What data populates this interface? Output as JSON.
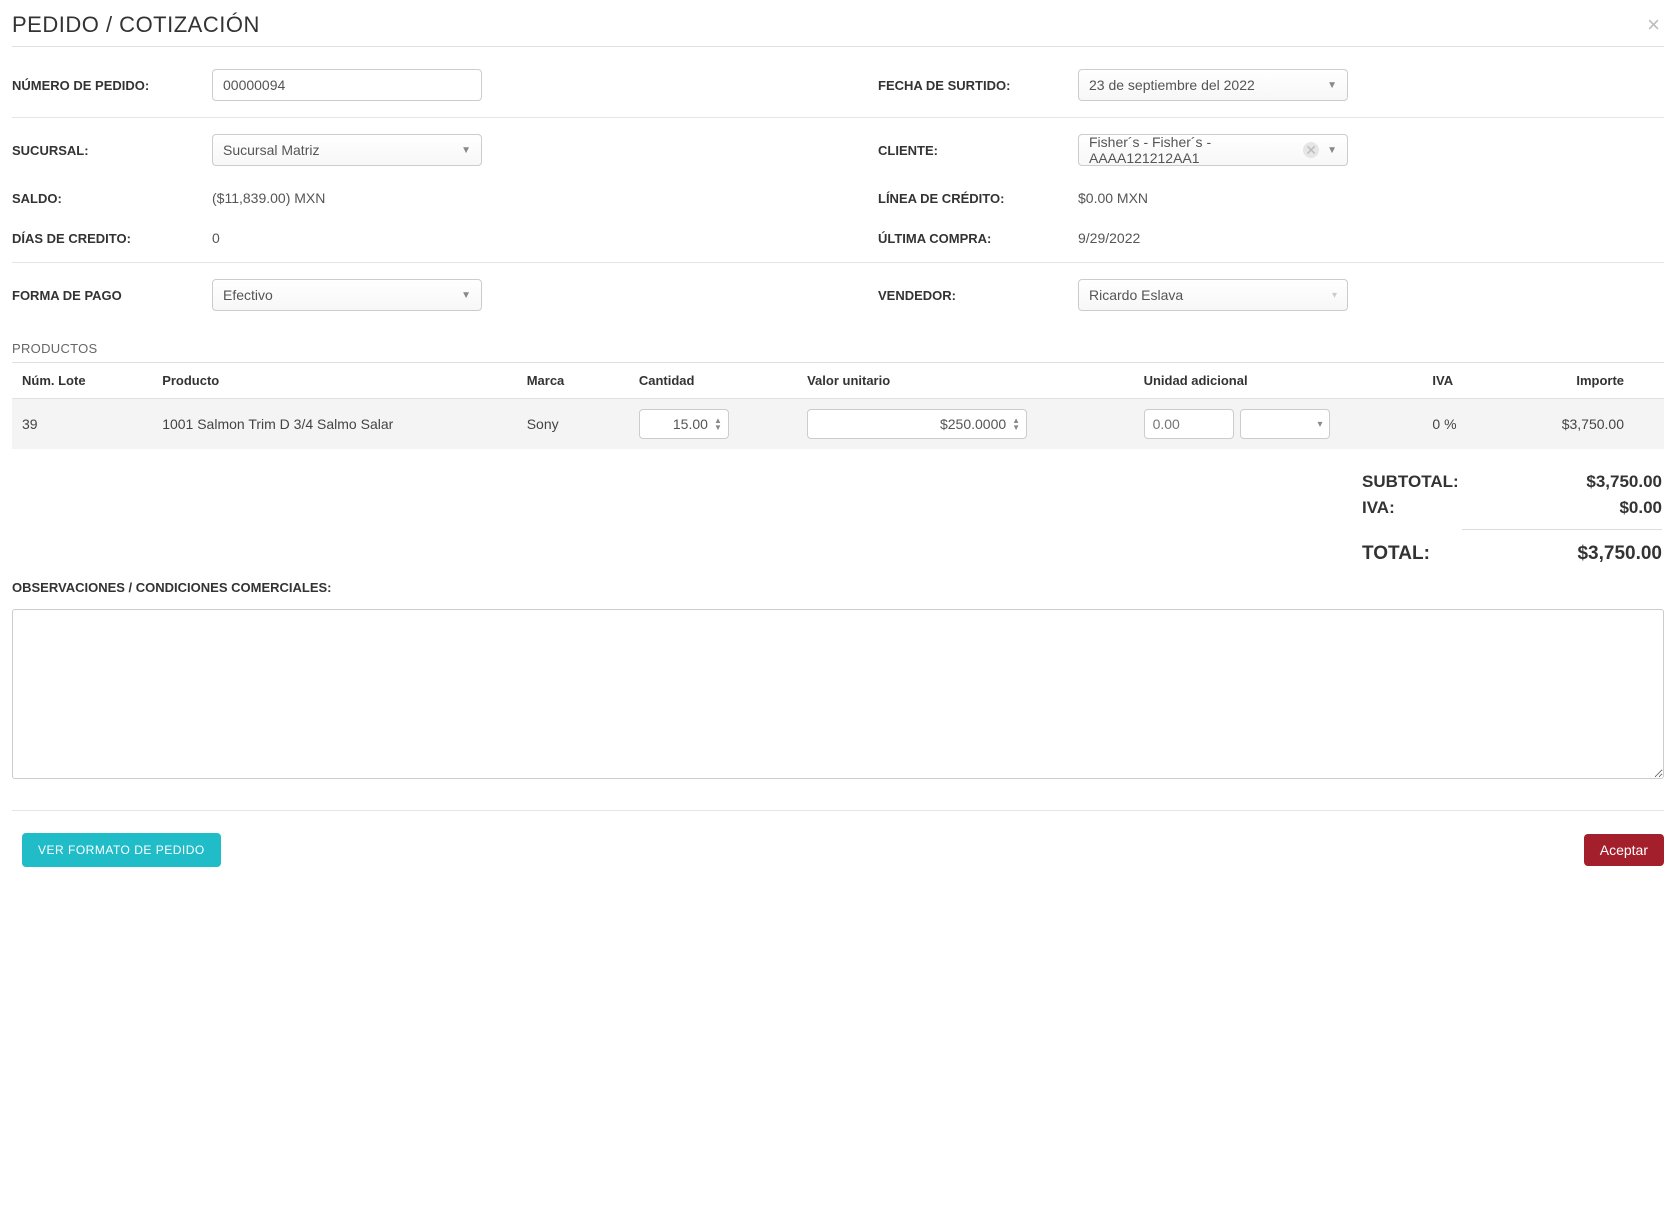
{
  "title": "PEDIDO / COTIZACIÓN",
  "labels": {
    "numero_pedido": "NÚMERO DE PEDIDO:",
    "fecha_surtido": "FECHA DE SURTIDO:",
    "sucursal": "SUCURSAL:",
    "cliente": "CLIENTE:",
    "saldo": "SALDO:",
    "linea_credito": "LÍNEA DE CRÉDITO:",
    "dias_credito": "DÍAS DE CREDITO:",
    "ultima_compra": "ÚLTIMA COMPRA:",
    "forma_pago": "FORMA DE PAGO",
    "vendedor": "VENDEDOR:",
    "productos": "PRODUCTOS",
    "observaciones": "OBSERVACIONES / CONDICIONES COMERCIALES:",
    "subtotal": "SUBTOTAL:",
    "iva": "IVA:",
    "total": "TOTAL:"
  },
  "values": {
    "numero_pedido": "00000094",
    "fecha_surtido": "23 de septiembre del 2022",
    "sucursal": "Sucursal Matriz",
    "cliente": "Fisher´s - Fisher´s - AAAA121212AA1",
    "saldo": "($11,839.00) MXN",
    "linea_credito": "$0.00 MXN",
    "dias_credito": "0",
    "ultima_compra": "9/29/2022",
    "forma_pago": "Efectivo",
    "vendedor": "Ricardo Eslava"
  },
  "table": {
    "headers": {
      "num_lote": "Núm. Lote",
      "producto": "Producto",
      "marca": "Marca",
      "cantidad": "Cantidad",
      "valor_unitario": "Valor unitario",
      "unidad_adicional": "Unidad adicional",
      "iva": "IVA",
      "importe": "Importe"
    },
    "rows": [
      {
        "num_lote": "39",
        "producto": "1001 Salmon Trim D 3/4 Salmo Salar",
        "marca": "Sony",
        "cantidad": "15.00",
        "valor_unitario": "$250.0000",
        "unidad_adicional": "0.00",
        "unidad_select": "",
        "iva": "0 %",
        "importe": "$3,750.00"
      }
    ]
  },
  "totals": {
    "subtotal": "$3,750.00",
    "iva": "$0.00",
    "total": "$3,750.00"
  },
  "buttons": {
    "ver_formato": "VER FORMATO DE PEDIDO",
    "aceptar": "Aceptar"
  }
}
